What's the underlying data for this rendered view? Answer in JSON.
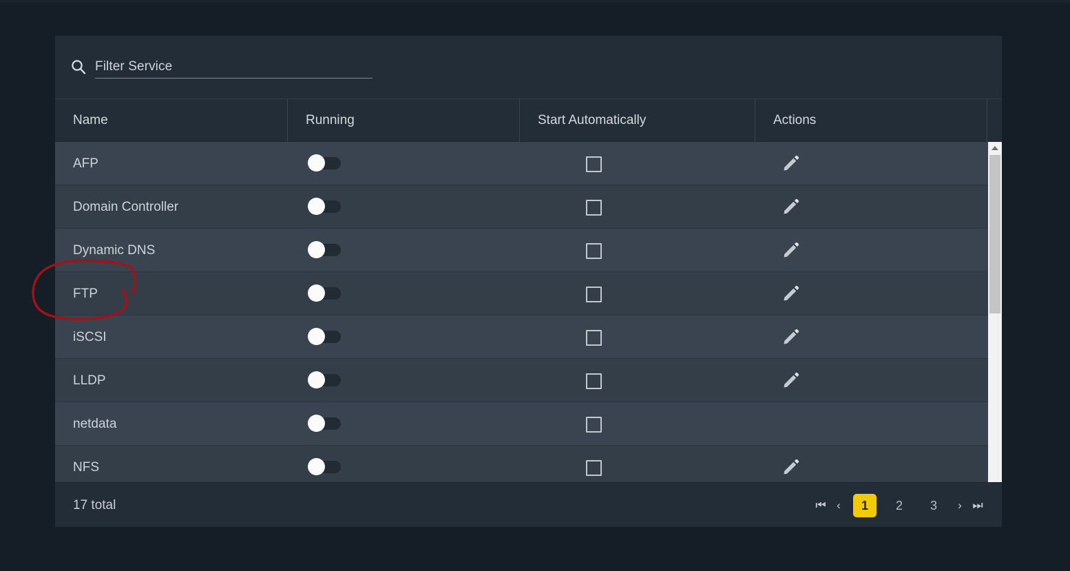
{
  "search": {
    "placeholder": "Filter Service",
    "value": "",
    "icon": "search-icon"
  },
  "table": {
    "columns": [
      "Name",
      "Running",
      "Start Automatically",
      "Actions"
    ],
    "rows": [
      {
        "name": "AFP",
        "running": false,
        "start_automatically": false,
        "has_edit": true
      },
      {
        "name": "Domain Controller",
        "running": false,
        "start_automatically": false,
        "has_edit": true
      },
      {
        "name": "Dynamic DNS",
        "running": false,
        "start_automatically": false,
        "has_edit": true
      },
      {
        "name": "FTP",
        "running": false,
        "start_automatically": false,
        "has_edit": true
      },
      {
        "name": "iSCSI",
        "running": false,
        "start_automatically": false,
        "has_edit": true
      },
      {
        "name": "LLDP",
        "running": false,
        "start_automatically": false,
        "has_edit": true
      },
      {
        "name": "netdata",
        "running": false,
        "start_automatically": false,
        "has_edit": false
      },
      {
        "name": "NFS",
        "running": false,
        "start_automatically": false,
        "has_edit": true
      }
    ]
  },
  "footer": {
    "total_label": "17 total",
    "pagination": {
      "first_label": "⏮",
      "prev_label": "‹",
      "pages": [
        "1",
        "2",
        "3"
      ],
      "active_page": "1",
      "next_label": "›",
      "last_label": "⏭"
    }
  },
  "annotation": {
    "kind": "hand-drawn-circle",
    "target": "FTP",
    "color": "#a21216"
  },
  "colors": {
    "page_background": "#151d27",
    "card_background": "#242e38",
    "header_background": "#232d38",
    "row_odd": "#394450",
    "row_even": "#333e49",
    "text_primary": "#ced3d9",
    "accent": "#f2cb07",
    "toggle_knob": "#fbfbfb",
    "toggle_track": "#222a32",
    "scrollbar_track": "#f2f2f2",
    "scrollbar_thumb": "#c4c4c4"
  }
}
